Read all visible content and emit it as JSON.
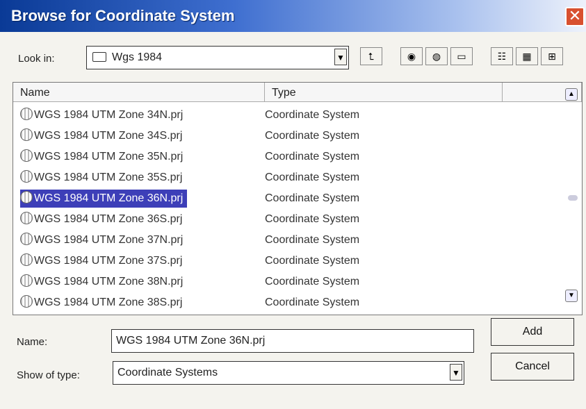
{
  "window": {
    "title": "Browse for Coordinate System",
    "close_glyph": "✕"
  },
  "look_in": {
    "label": "Look in:",
    "value": "Wgs 1984",
    "icon": "folder-icon"
  },
  "toolbar": {
    "buttons": [
      {
        "name": "up-one-level-button",
        "glyph": "⮤"
      },
      {
        "name": "connect-folder-button",
        "glyph": "◉"
      },
      {
        "name": "disconnect-folder-button",
        "glyph": "◍"
      },
      {
        "name": "new-folder-button",
        "glyph": "▭"
      },
      {
        "name": "list-view-button",
        "glyph": "☷"
      },
      {
        "name": "details-view-button",
        "glyph": "▦"
      },
      {
        "name": "thumbnail-view-button",
        "glyph": "⊞"
      }
    ]
  },
  "columns": {
    "name": "Name",
    "type": "Type"
  },
  "files": [
    {
      "name": "WGS 1984 UTM Zone 34N.prj",
      "type": "Coordinate System"
    },
    {
      "name": "WGS 1984 UTM Zone 34S.prj",
      "type": "Coordinate System"
    },
    {
      "name": "WGS 1984 UTM Zone 35N.prj",
      "type": "Coordinate System"
    },
    {
      "name": "WGS 1984 UTM Zone 35S.prj",
      "type": "Coordinate System"
    },
    {
      "name": "WGS 1984 UTM Zone 36N.prj",
      "type": "Coordinate System",
      "selected": true
    },
    {
      "name": "WGS 1984 UTM Zone 36S.prj",
      "type": "Coordinate System"
    },
    {
      "name": "WGS 1984 UTM Zone 37N.prj",
      "type": "Coordinate System"
    },
    {
      "name": "WGS 1984 UTM Zone 37S.prj",
      "type": "Coordinate System"
    },
    {
      "name": "WGS 1984 UTM Zone 38N.prj",
      "type": "Coordinate System"
    },
    {
      "name": "WGS 1984 UTM Zone 38S.prj",
      "type": "Coordinate System"
    }
  ],
  "name_field": {
    "label": "Name:",
    "value": "WGS 1984 UTM Zone 36N.prj"
  },
  "type_field": {
    "label": "Show of type:",
    "value": "Coordinate Systems"
  },
  "buttons": {
    "add": "Add",
    "cancel": "Cancel"
  },
  "colors": {
    "selection": "#3d3fb8",
    "titlebar": "#0a3a96"
  }
}
